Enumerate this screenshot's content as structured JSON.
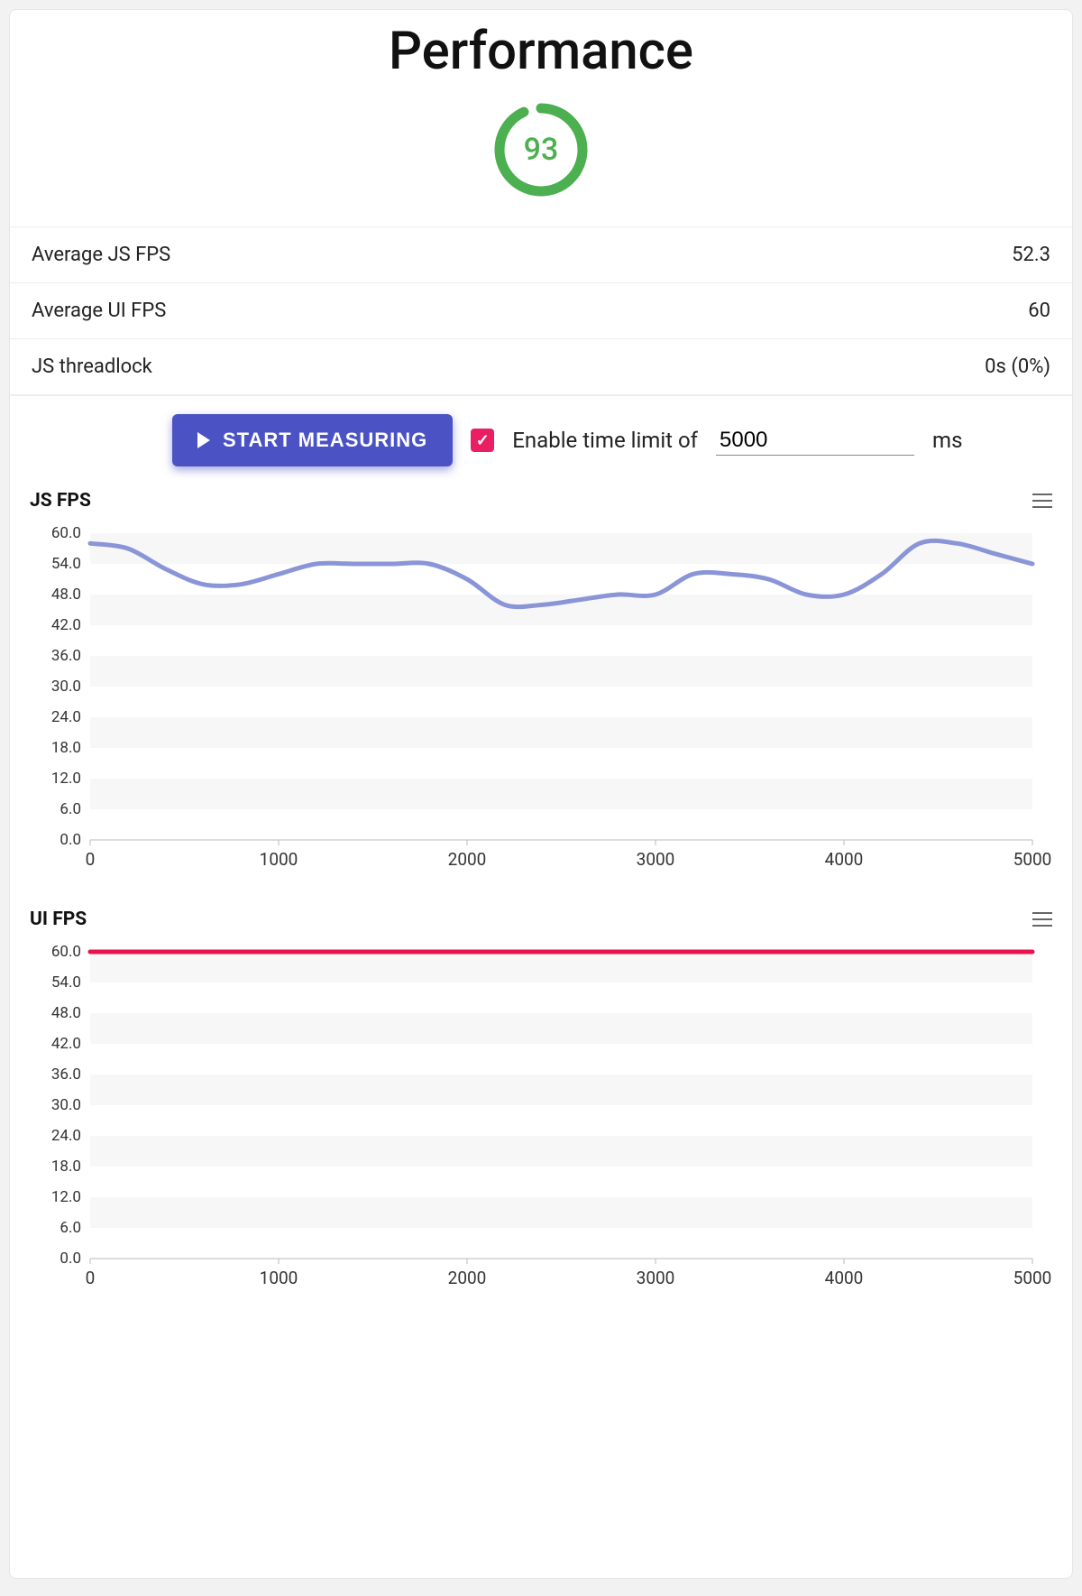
{
  "title": "Performance",
  "score": 93,
  "score_color": "#4caf50",
  "metrics": [
    {
      "label": "Average JS FPS",
      "value": "52.3"
    },
    {
      "label": "Average UI FPS",
      "value": "60"
    },
    {
      "label": "JS threadlock",
      "value": "0s (0%)"
    }
  ],
  "controls": {
    "start_label": "START MEASURING",
    "enable_label": "Enable time limit of",
    "time_value": "5000",
    "time_unit": "ms",
    "checkbox_checked": true
  },
  "charts": {
    "js": {
      "title": "JS FPS"
    },
    "ui": {
      "title": "UI FPS"
    }
  },
  "chart_data": [
    {
      "type": "line",
      "title": "JS FPS",
      "xlabel": "",
      "ylabel": "",
      "xlim": [
        0,
        5000
      ],
      "ylim": [
        0,
        60
      ],
      "x_ticks": [
        0,
        1000,
        2000,
        3000,
        4000,
        5000
      ],
      "y_ticks": [
        0.0,
        6.0,
        12.0,
        18.0,
        24.0,
        30.0,
        36.0,
        42.0,
        48.0,
        54.0,
        60.0
      ],
      "series": [
        {
          "name": "JS FPS",
          "color": "#8a95d8",
          "x": [
            0,
            200,
            400,
            600,
            800,
            1000,
            1200,
            1400,
            1600,
            1800,
            2000,
            2200,
            2400,
            2600,
            2800,
            3000,
            3200,
            3400,
            3600,
            3800,
            4000,
            4200,
            4400,
            4600,
            4800,
            5000
          ],
          "values": [
            58,
            57,
            53,
            50,
            50,
            52,
            54,
            54,
            54,
            54,
            51,
            46,
            46,
            47,
            48,
            48,
            52,
            52,
            51,
            48,
            48,
            52,
            58,
            58,
            56,
            54
          ]
        }
      ]
    },
    {
      "type": "line",
      "title": "UI FPS",
      "xlabel": "",
      "ylabel": "",
      "xlim": [
        0,
        5000
      ],
      "ylim": [
        0,
        60
      ],
      "x_ticks": [
        0,
        1000,
        2000,
        3000,
        4000,
        5000
      ],
      "y_ticks": [
        0.0,
        6.0,
        12.0,
        18.0,
        24.0,
        30.0,
        36.0,
        42.0,
        48.0,
        54.0,
        60.0
      ],
      "series": [
        {
          "name": "UI FPS",
          "color": "#e6144d",
          "x": [
            0,
            1000,
            2000,
            3000,
            4000,
            5000
          ],
          "values": [
            60,
            60,
            60,
            60,
            60,
            60
          ]
        }
      ]
    }
  ]
}
